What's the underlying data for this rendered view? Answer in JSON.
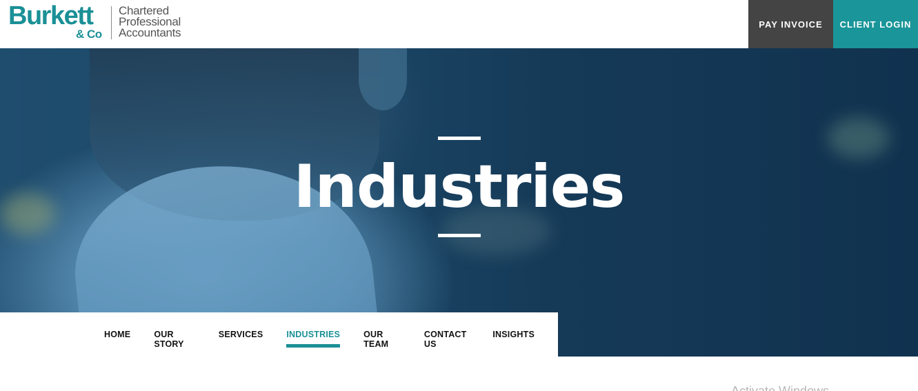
{
  "brand": {
    "name": "Burkett",
    "suffix": "& Co",
    "tagline_lines": [
      "Chartered",
      "Professional",
      "Accountants"
    ],
    "accent_color": "#1a9096"
  },
  "header": {
    "pay_invoice_label": "PAY INVOICE",
    "client_login_label": "CLIENT LOGIN",
    "pay_invoice_color": "#444444",
    "client_login_color": "#1a9599"
  },
  "hero": {
    "title": "Industries"
  },
  "subnav": {
    "items": [
      {
        "label": "HOME",
        "active": false
      },
      {
        "label": "OUR STORY",
        "active": false
      },
      {
        "label": "SERVICES",
        "active": false
      },
      {
        "label": "INDUSTRIES",
        "active": true
      },
      {
        "label": "OUR TEAM",
        "active": false
      },
      {
        "label": "CONTACT US",
        "active": false
      },
      {
        "label": "INSIGHTS",
        "active": false
      }
    ]
  },
  "watermark": {
    "text": "Activate Windows"
  }
}
